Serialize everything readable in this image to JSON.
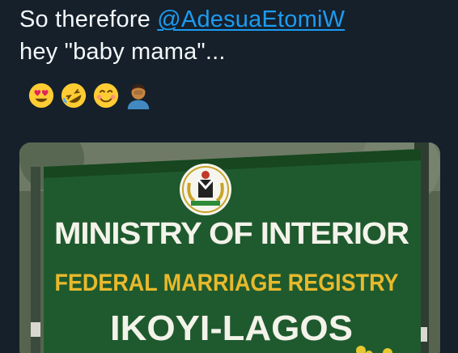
{
  "tweet": {
    "line1_prefix": "So therefore ",
    "mention": "@AdesuaEtomiW",
    "line2": "hey \"baby mama\"...",
    "emojis": [
      "heart-eyes-emoji",
      "rolling-laughing-emoji",
      "smiling-emoji",
      "facepalm-emoji"
    ]
  },
  "media": {
    "sign": {
      "line1": "MINISTRY OF INTERIOR",
      "line2": "FEDERAL MARRIAGE REGISTRY",
      "line3": "IKOYI-LAGOS"
    },
    "colors": {
      "board": "#1f5a2e",
      "board_dark": "#17461f",
      "text_white": "#f3f3ea",
      "text_yellow": "#e8b92c",
      "post": "#3a4a3d"
    }
  }
}
